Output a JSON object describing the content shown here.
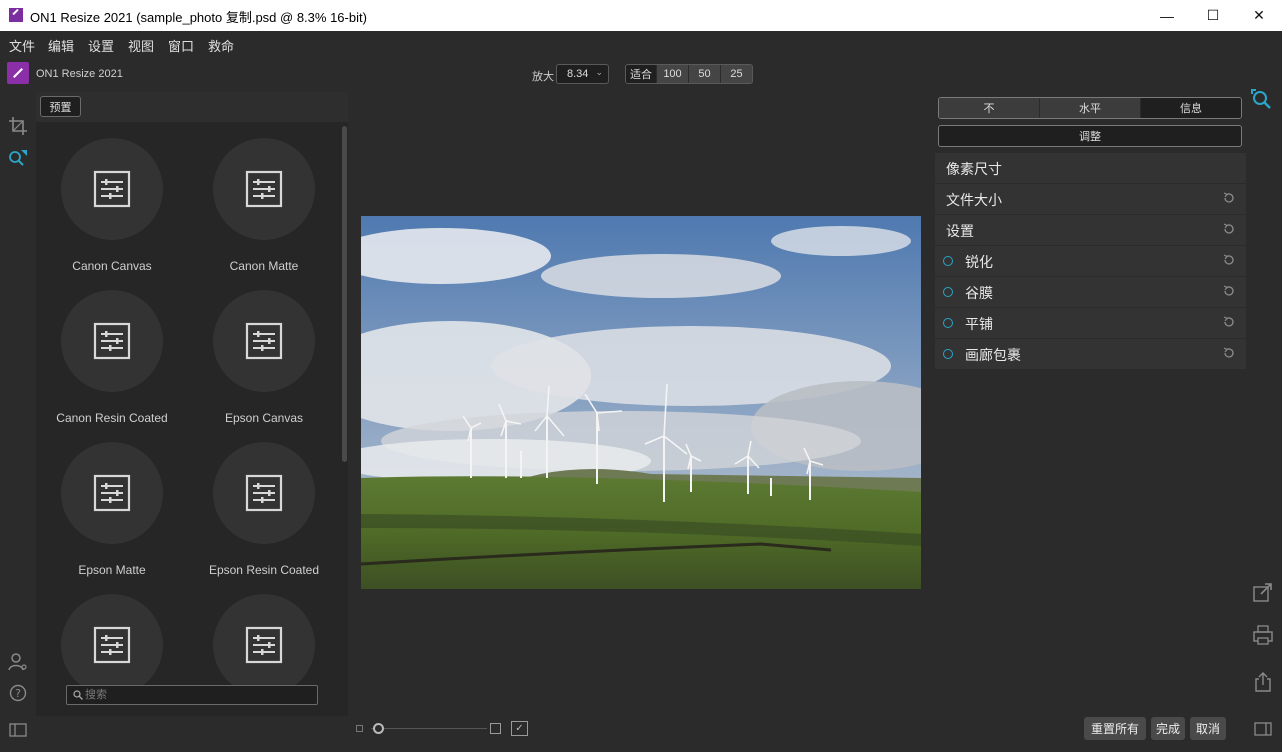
{
  "window": {
    "title": "ON1 Resize 2021 (sample_photo 复制.psd @ 8.3% 16-bit)",
    "minimize": "—",
    "maximize": "☐",
    "close": "✕"
  },
  "menu": [
    "文件",
    "编辑",
    "设置",
    "视图",
    "窗口",
    "救命"
  ],
  "toolbar": {
    "brand": "ON1 Resize 2021",
    "zoom_label": "放大",
    "zoom_value": "8.34",
    "zoom_presets": [
      "适合",
      "100",
      "50",
      "25"
    ]
  },
  "presets": {
    "button": "预置",
    "items": [
      {
        "label": "Canon Canvas"
      },
      {
        "label": "Canon Matte"
      },
      {
        "label": "Canon Resin Coated"
      },
      {
        "label": "Epson Canvas"
      },
      {
        "label": "Epson Matte"
      },
      {
        "label": "Epson Resin Coated"
      },
      {
        "label": ""
      },
      {
        "label": ""
      }
    ],
    "search_placeholder": "搜索"
  },
  "right_panel": {
    "tabs": [
      "不",
      "水平",
      "信息"
    ],
    "adjust": "调整",
    "sections": [
      {
        "label": "像素尺寸",
        "toggle": false,
        "reset": false
      },
      {
        "label": "文件大小",
        "toggle": false,
        "reset": true
      },
      {
        "label": "设置",
        "toggle": false,
        "reset": true
      },
      {
        "label": "锐化",
        "toggle": true,
        "reset": true
      },
      {
        "label": "谷膜",
        "toggle": true,
        "reset": true
      },
      {
        "label": "平铺",
        "toggle": true,
        "reset": true
      },
      {
        "label": "画廊包裹",
        "toggle": true,
        "reset": true
      }
    ]
  },
  "bottom": {
    "reset_all": "重置所有",
    "done": "完成",
    "cancel": "取消"
  },
  "colors": {
    "accent": "#2aa6c8",
    "brand": "#8a2fa8"
  }
}
